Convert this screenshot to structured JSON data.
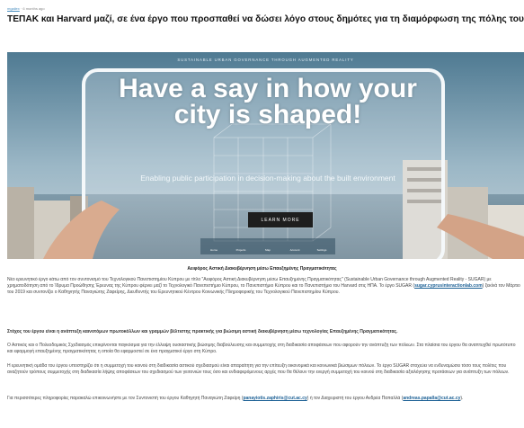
{
  "meta": {
    "author": "mgailex",
    "time": "6 months ago"
  },
  "article": {
    "title": "ΤΕΠΑΚ και Harvard μαζί, σε ένα έργο που προσπαθεί να δώσει λόγο στους δημότες για τη διαμόρφωση της πόλης τους"
  },
  "hero": {
    "banner": "SUSTAINABLE URBAN GOVERNANCE THROUGH AUGMENTED REALITY",
    "headline": "Have a say in how your city is shaped!",
    "subline": "Enabling public participation in decision-making about the built environment",
    "button": "LEARN MORE",
    "tabs": [
      "Home",
      "Projects",
      "Map",
      "Account",
      "Settings"
    ]
  },
  "caption": "Αειφόρος Αστική Διακυβέρνηση μέσω Επαυξημένης Πραγματικότητας",
  "paragraphs": {
    "p1_a": "Νέο ερευνητικό έργο κάτω από τον συντονισμό του Τεχνολογικού Πανεπιστημίου Κύπρου με τίτλο \"Αειφόρος Αστική Διακυβέρνηση μέσω Επαυξημένης Πραγματικότητας\" (Sustainable Urban Governance through Augmented Reality - SUGAR) με χρηματοδότηση από το Ίδρυμα Προώθησης Έρευνας της Κύπρου φέρνει μαζί το Τεχνολογικό Πανεπιστήμιο Κύπρου, το Πανεπιστήμιο Κύπρου και το Πανεπιστήμιο του Harvard στις ΗΠΑ. Το έργο SUGAR (",
    "p1_link": "sugar.cyprusinteractionlab.com",
    "p1_b": ") ξεκίνά τον Μάρτιο του 2019 και συντονίζει ο Καθηγητής Παναγιώτης Ζαφείρης, Διευθυντής του Ερευνητικού Κέντρου Κοινωνικής Πληροφορικής του Τεχνολογικού Πανεπιστημίου Κύπρου.",
    "p2": "Στόχος του έργου είναι η ανάπτυξη καινοτόμων πρωτοκόλλων και γραμμών βέλτιστης πρακτικής για βιώσιμη αστική διακυβέρνηση μέσω τεχνολογίας Επαυξημένης Πραγματικότητας.",
    "p3": "Ο Αστικός και ο Πολεοδομικός Σχεδιασμός επικρίνονται παγκόσμια για την έλλειψη ουσιαστικής βιώσιμης διαβούλευσης και συμμετοχής στη διαδικασία αποφάσεων που αφορούν την ανάπτυξη των πόλεων. Στα πλαίσια του έργου θα αναπτυχθεί πρωτότυπο και εφαρμογή επαυξημένης πραγματικότητας η οποία θα εφαρμοστεί σε ένα πραγματικό έργο στη Κύπρο.",
    "p4": "Η ερευνητική ομάδα του έργου υποστηρίζει ότι η συμμετοχή του κοινού στη διαδικασία αστικού σχεδιασμού είναι απαραίτητη για την επίτευξη οικονομικά και κοινωνικά βιώσιμων πόλεων. Το έργο SUGAR στοχεύει να ενδυναμώσει τόσο τους πολίτες που αναζητούν τρόπους συμμετοχής στη διαδικασία λήψης αποφάσεων του σχεδιασμού των γειτονιών τους όσο και ενδιαφερόμενους αρχές που θα θέλουν την ενεργή συμμετοχή του κοινού στη διαδικασία αξιολόγησης προτάσεων για ανάπτυξη των πόλεων.",
    "p5_a": "Για περισσότερες πληροφορίες παρακαλώ επικοινωνήστε με τον Συντονιστή του έργου Καθηγητή Παναγιώτη Ζαφείρη (",
    "p5_link1": "panayiotis.zaphiris@cut.ac.cy",
    "p5_b": ") ή τον Διαχειριστή του έργου Ανδρέα Παπαλλά (",
    "p5_link2": "andreas.papalla@cut.ac.cy",
    "p5_c": ")."
  },
  "colors": {
    "link": "#1a5f94",
    "hero_sky": "#5a7f95",
    "button": "#1e1e1e"
  }
}
